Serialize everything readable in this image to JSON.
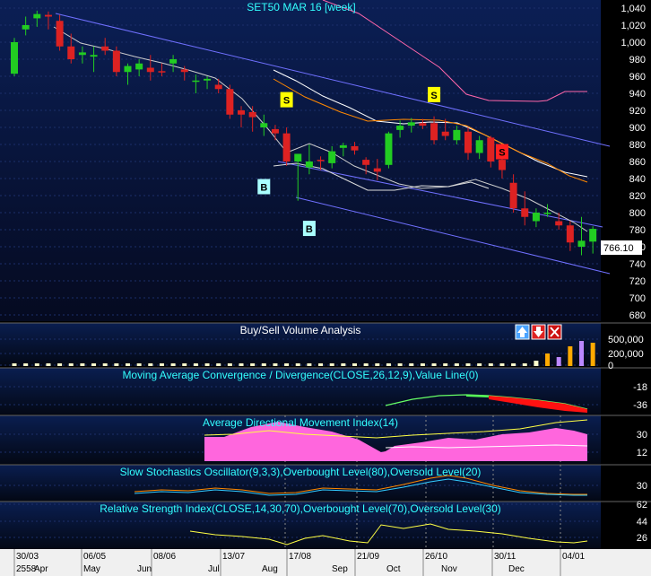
{
  "chart_data": {
    "type": "candlestick",
    "title": "SET50 MAR 16  [week]",
    "ylim": [
      660,
      1045
    ],
    "yticks": [
      680,
      700,
      720,
      740,
      760,
      780,
      800,
      820,
      840,
      860,
      880,
      900,
      920,
      940,
      960,
      980,
      1000,
      1020,
      1040
    ],
    "last_price": "766.10",
    "candles": [
      {
        "o": 963,
        "h": 1005,
        "l": 960,
        "c": 1000
      },
      {
        "o": 1015,
        "h": 1030,
        "l": 1008,
        "c": 1020
      },
      {
        "o": 1028,
        "h": 1037,
        "l": 1018,
        "c": 1033
      },
      {
        "o": 1032,
        "h": 1036,
        "l": 1015,
        "c": 1030
      },
      {
        "o": 1025,
        "h": 1032,
        "l": 990,
        "c": 995
      },
      {
        "o": 995,
        "h": 1010,
        "l": 975,
        "c": 980
      },
      {
        "o": 985,
        "h": 995,
        "l": 975,
        "c": 988
      },
      {
        "o": 983,
        "h": 995,
        "l": 965,
        "c": 985
      },
      {
        "o": 995,
        "h": 1005,
        "l": 985,
        "c": 990
      },
      {
        "o": 990,
        "h": 995,
        "l": 960,
        "c": 965
      },
      {
        "o": 965,
        "h": 975,
        "l": 950,
        "c": 972
      },
      {
        "o": 968,
        "h": 980,
        "l": 960,
        "c": 975
      },
      {
        "o": 970,
        "h": 985,
        "l": 955,
        "c": 965
      },
      {
        "o": 966,
        "h": 975,
        "l": 960,
        "c": 965
      },
      {
        "o": 975,
        "h": 985,
        "l": 965,
        "c": 980
      },
      {
        "o": 968,
        "h": 972,
        "l": 955,
        "c": 965
      },
      {
        "o": 955,
        "h": 962,
        "l": 940,
        "c": 955
      },
      {
        "o": 955,
        "h": 960,
        "l": 945,
        "c": 957
      },
      {
        "o": 950,
        "h": 957,
        "l": 940,
        "c": 945
      },
      {
        "o": 945,
        "h": 950,
        "l": 910,
        "c": 915
      },
      {
        "o": 920,
        "h": 925,
        "l": 900,
        "c": 915
      },
      {
        "o": 918,
        "h": 925,
        "l": 895,
        "c": 912
      },
      {
        "o": 900,
        "h": 915,
        "l": 890,
        "c": 905
      },
      {
        "o": 898,
        "h": 903,
        "l": 885,
        "c": 893
      },
      {
        "o": 893,
        "h": 900,
        "l": 855,
        "c": 860
      },
      {
        "o": 860,
        "h": 868,
        "l": 814,
        "c": 869
      },
      {
        "o": 853,
        "h": 880,
        "l": 845,
        "c": 860
      },
      {
        "o": 862,
        "h": 866,
        "l": 850,
        "c": 861
      },
      {
        "o": 858,
        "h": 878,
        "l": 852,
        "c": 872
      },
      {
        "o": 876,
        "h": 882,
        "l": 866,
        "c": 879
      },
      {
        "o": 878,
        "h": 883,
        "l": 868,
        "c": 873
      },
      {
        "o": 862,
        "h": 865,
        "l": 845,
        "c": 856
      },
      {
        "o": 852,
        "h": 863,
        "l": 838,
        "c": 848
      },
      {
        "o": 856,
        "h": 895,
        "l": 852,
        "c": 893
      },
      {
        "o": 897,
        "h": 908,
        "l": 888,
        "c": 902
      },
      {
        "o": 902,
        "h": 911,
        "l": 894,
        "c": 906
      },
      {
        "o": 905,
        "h": 910,
        "l": 898,
        "c": 902
      },
      {
        "o": 905,
        "h": 913,
        "l": 880,
        "c": 885
      },
      {
        "o": 895,
        "h": 910,
        "l": 885,
        "c": 890
      },
      {
        "o": 885,
        "h": 902,
        "l": 880,
        "c": 897
      },
      {
        "o": 895,
        "h": 900,
        "l": 862,
        "c": 870
      },
      {
        "o": 870,
        "h": 890,
        "l": 863,
        "c": 885
      },
      {
        "o": 888,
        "h": 890,
        "l": 853,
        "c": 860
      },
      {
        "o": 862,
        "h": 870,
        "l": 840,
        "c": 850
      },
      {
        "o": 835,
        "h": 845,
        "l": 800,
        "c": 805
      },
      {
        "o": 805,
        "h": 825,
        "l": 785,
        "c": 795
      },
      {
        "o": 790,
        "h": 805,
        "l": 783,
        "c": 800
      },
      {
        "o": 800,
        "h": 810,
        "l": 795,
        "c": 800
      },
      {
        "o": 790,
        "h": 800,
        "l": 780,
        "c": 785
      },
      {
        "o": 785,
        "h": 790,
        "l": 755,
        "c": 765
      },
      {
        "o": 760,
        "h": 795,
        "l": 750,
        "c": 767
      },
      {
        "o": 766,
        "h": 784,
        "l": 752,
        "c": 781
      }
    ],
    "signals": [
      {
        "label": "S",
        "candle": 24,
        "price": 932,
        "color": "#ffff00"
      },
      {
        "label": "B",
        "candle": 22,
        "price": 830,
        "color": "#aaffff"
      },
      {
        "label": "B",
        "candle": 26,
        "price": 781,
        "color": "#aaffff"
      },
      {
        "label": "S",
        "candle": 37,
        "price": 938,
        "color": "#ffff00"
      },
      {
        "label": "S",
        "candle": 43,
        "price": 871,
        "color": "#ff2020"
      }
    ],
    "x_labels_top": [
      "30/03",
      "06/05",
      "08/06",
      "13/07",
      "17/08",
      "21/09",
      "26/10",
      "30/11",
      "04/01"
    ],
    "x_labels_bottom": [
      "Apr",
      "May",
      "Jun",
      "Jul",
      "Aug",
      "Sep",
      "Oct",
      "Nov",
      "Dec"
    ],
    "x_label_year": "2558",
    "panels": [
      {
        "title": "Buy/Sell Volume Analysis",
        "title_color": "#ffffff",
        "ticks": [
          "500,000",
          "200,000",
          "0"
        ]
      },
      {
        "title": "Moving Average Convergence / Divergence(CLOSE,26,12,9),Value Line(0)",
        "title_color": "#33ffff",
        "ticks": [
          "-18",
          "-36"
        ]
      },
      {
        "title": "Average Directional Movement Index(14)",
        "title_color": "#33ffff",
        "ticks": [
          "30",
          "12"
        ]
      },
      {
        "title": "Slow Stochastics Oscillator(9,3,3),Overbought Level(80),Oversold Level(20)",
        "title_color": "#33ffff",
        "ticks": [
          "30"
        ]
      },
      {
        "title": "Relative Strength Index(CLOSE,14,30,70),Overbought Level(70),Oversold Level(30)",
        "title_color": "#33ffff",
        "ticks": [
          "62",
          "44",
          "26"
        ]
      }
    ]
  }
}
